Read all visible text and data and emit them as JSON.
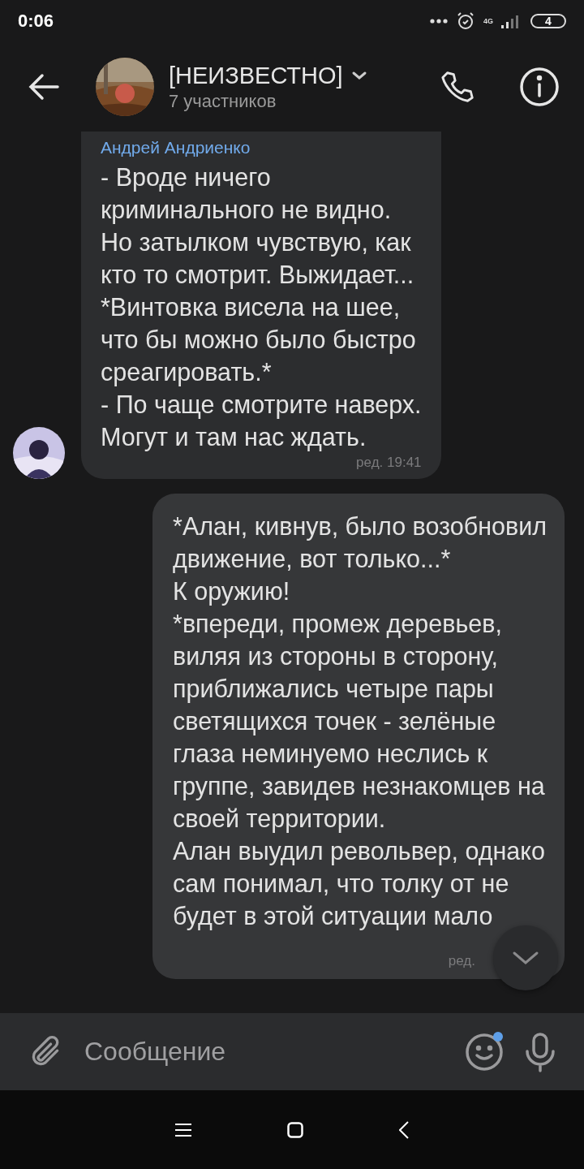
{
  "status_bar": {
    "time": "0:06",
    "network": "4G",
    "battery": "4"
  },
  "header": {
    "title": "[НЕИЗВЕСТНО]",
    "subtitle": "7 участников"
  },
  "messages": [
    {
      "kind": "incoming",
      "sender": "Андрей Андриенко",
      "text": "- Вроде ничего\nкриминального не видно.\nНо затылком чувствую, как\nкто то смотрит. Выжидает...\n*Винтовка висела на шее,\nчто бы можно было быстро\nсреагировать.*\n- По чаще смотрите наверх.\nМогут и там нас ждать.",
      "time": "ред. 19:41"
    },
    {
      "kind": "outgoing",
      "text": "*Алан, кивнув, было возобновил\nдвижение, вот только...*\nК оружию!\n*впереди, промеж деревьев,\nвиляя из стороны в сторону,\nприближались четыре пары\nсветящихся точек - зелёные\nглаза неминуемо неслись к\nгруппе, завидев незнакомцев на\nсвоей территории.\nАлан выудил револьвер, однако\nсам понимал, что толку от не\nбудет в этой ситуации мало",
      "time": "ред."
    }
  ],
  "composer": {
    "placeholder": "Сообщение",
    "emoji_badge": true
  }
}
